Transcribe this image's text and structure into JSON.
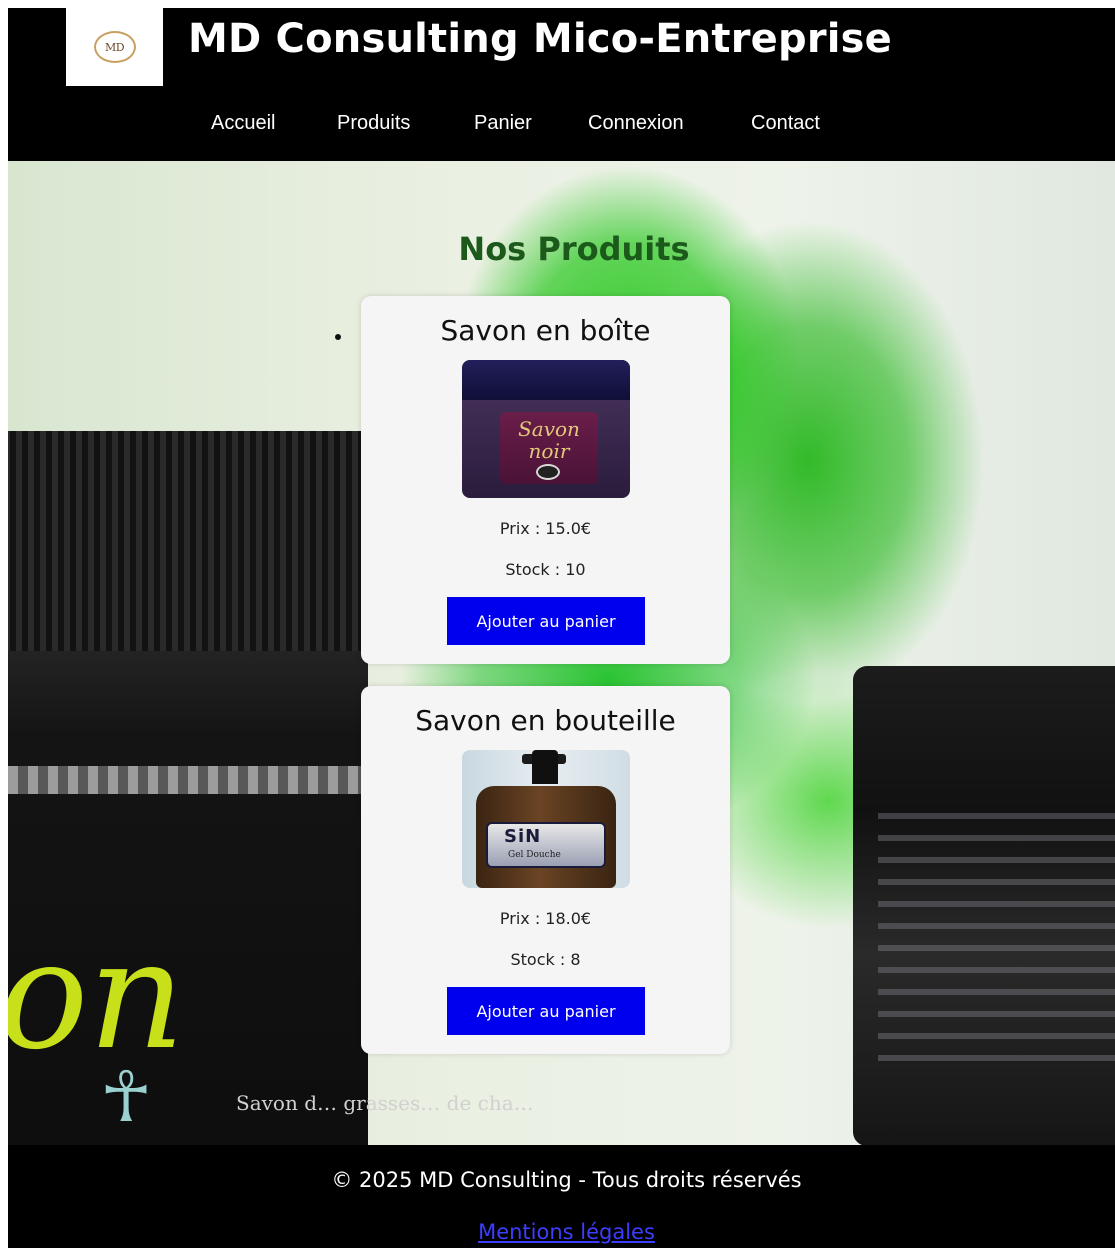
{
  "header": {
    "logo_text": "MD",
    "site_title": "MD Consulting Mico-Entreprise",
    "nav": [
      {
        "label": "Accueil"
      },
      {
        "label": "Produits"
      },
      {
        "label": "Panier"
      },
      {
        "label": "Connexion"
      },
      {
        "label": "Contact"
      }
    ]
  },
  "hero": {
    "jar_script": "on",
    "jar_small_text": "Savon d… grasses… de cha…"
  },
  "main": {
    "title": "Nos Produits",
    "products": [
      {
        "name": "Savon en boîte",
        "image_text": "Savon noir",
        "price": "Prix : 15.0€",
        "stock": "Stock : 10",
        "button": "Ajouter au panier"
      },
      {
        "name": "Savon en bouteille",
        "image_text": "SiN",
        "image_subtext": "Gel Douche",
        "price": "Prix : 18.0€",
        "stock": "Stock : 8",
        "button": "Ajouter au panier"
      }
    ]
  },
  "footer": {
    "copyright": "© 2025 MD Consulting - Tous droits réservés",
    "legal_link": "Mentions légales"
  },
  "colors": {
    "header_bg": "#000000",
    "title_green": "#1c5a1c",
    "button_blue": "#0000ee",
    "link_blue": "#3d3dff",
    "card_bg": "#f5f5f5"
  }
}
